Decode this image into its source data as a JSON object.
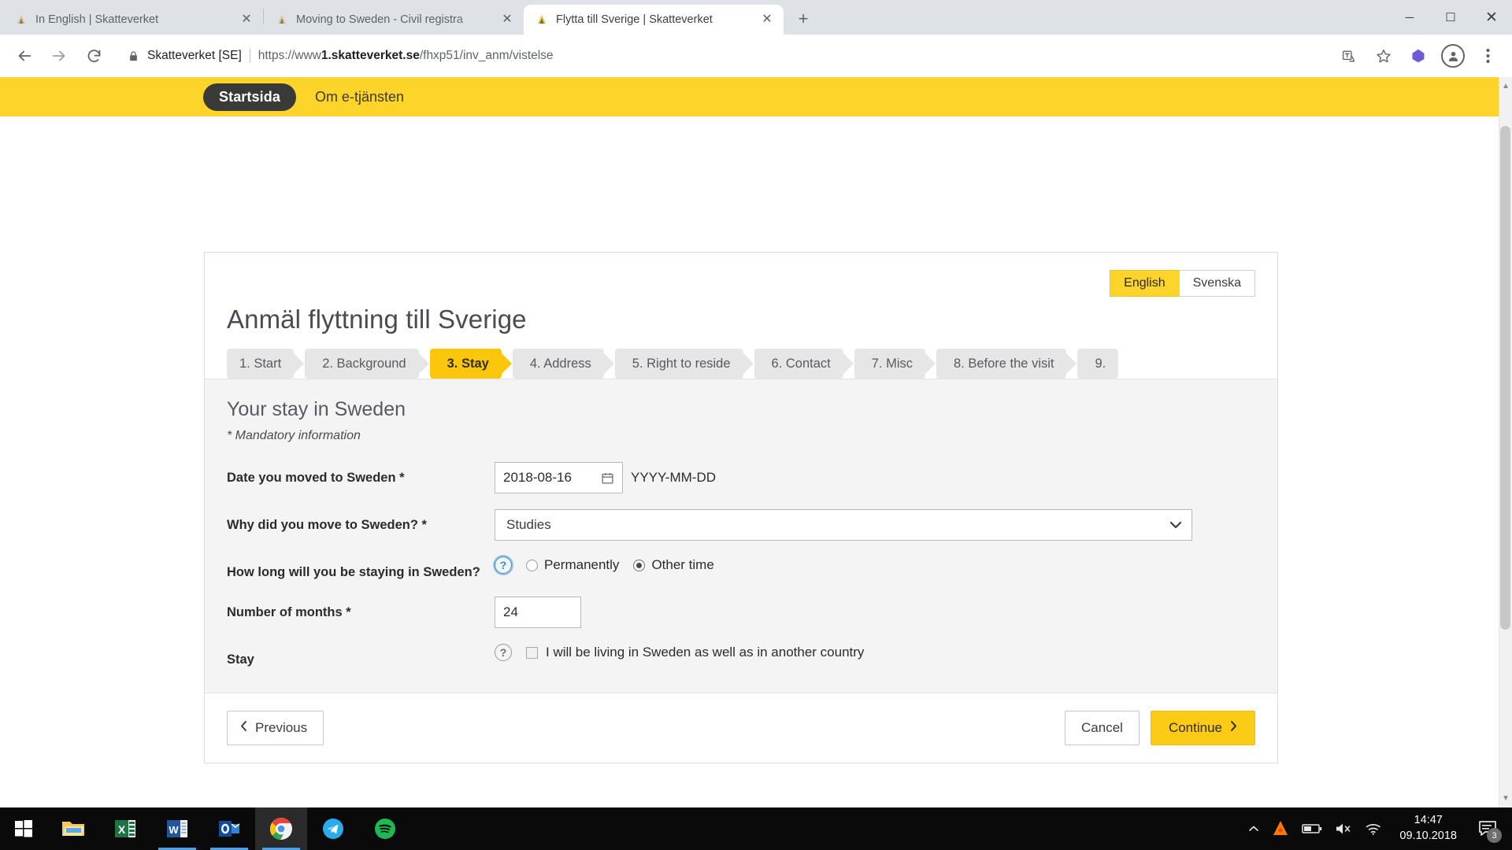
{
  "browser": {
    "tabs": [
      {
        "title": "In English | Skatteverket",
        "favicon": "skatteverket-favicon",
        "active": false
      },
      {
        "title": "Moving to Sweden - Civil registra",
        "favicon": "skatteverket-favicon",
        "active": false
      },
      {
        "title": "Flytta till Sverige | Skatteverket",
        "favicon": "skatteverket-favicon",
        "active": true
      }
    ],
    "new_tab_label": "+",
    "window_controls": {
      "minimize": "─",
      "maximize": "☐",
      "close": "✕"
    },
    "nav": {
      "back": "back-arrow-icon",
      "forward": "forward-arrow-icon",
      "reload": "reload-icon"
    },
    "omnibox": {
      "lock_icon": "lock-icon",
      "site_label": "Skatteverket [SE]",
      "url_prefix": "https://www",
      "url_bold": "1.skatteverket.se",
      "url_suffix": "/fhxp51/inv_anm/vistelse"
    },
    "toolbar_icons": [
      "translate-icon",
      "bookmark-star-icon",
      "extension-icon",
      "profile-avatar-icon",
      "more-menu-icon"
    ]
  },
  "topnav": {
    "home_label": "Startsida",
    "about_label": "Om e-tjänsten",
    "background_color": "#fdd42a"
  },
  "language": {
    "options": [
      "English",
      "Svenska"
    ],
    "selected": "English"
  },
  "page": {
    "title": "Anmäl flyttning till Sverige"
  },
  "steps": [
    {
      "label": "1. Start",
      "active": false
    },
    {
      "label": "2. Background",
      "active": false
    },
    {
      "label": "3. Stay",
      "active": true
    },
    {
      "label": "4. Address",
      "active": false
    },
    {
      "label": "5. Right to reside",
      "active": false
    },
    {
      "label": "6. Contact",
      "active": false
    },
    {
      "label": "7. Misc",
      "active": false
    },
    {
      "label": "8. Before the visit",
      "active": false
    },
    {
      "label": "9.",
      "active": false
    }
  ],
  "form": {
    "section_title": "Your stay in Sweden",
    "mandatory_note": "* Mandatory information",
    "date_moved": {
      "label": "Date you moved to Sweden *",
      "value": "2018-08-16",
      "format_hint": "YYYY-MM-DD",
      "calendar_icon": "calendar-icon"
    },
    "reason": {
      "label": "Why did you move to Sweden? *",
      "value": "Studies",
      "options": [
        "Studies"
      ],
      "chevron": "chevron-down-icon"
    },
    "duration": {
      "label": "How long will you be staying in Sweden?",
      "help_icon": "help-question-icon",
      "options": [
        {
          "label": "Permanently",
          "selected": false
        },
        {
          "label": "Other time",
          "selected": true
        }
      ]
    },
    "months": {
      "label": "Number of months *",
      "value": "24"
    },
    "stay": {
      "label": "Stay",
      "help_icon": "help-question-icon",
      "checkbox_label": "I will be living in Sweden as well as in another country",
      "checked": false
    }
  },
  "actions": {
    "previous": "Previous",
    "previous_icon": "chevron-left-icon",
    "cancel": "Cancel",
    "continue": "Continue",
    "continue_icon": "chevron-right-icon",
    "primary_color": "#fbcb16"
  },
  "taskbar": {
    "start_icon": "windows-start-icon",
    "items": [
      {
        "name": "file-explorer-icon",
        "running": false,
        "active": false
      },
      {
        "name": "excel-icon",
        "running": false,
        "active": false
      },
      {
        "name": "word-icon",
        "running": true,
        "active": false
      },
      {
        "name": "outlook-icon",
        "running": true,
        "active": false
      },
      {
        "name": "chrome-icon",
        "running": true,
        "active": true
      },
      {
        "name": "telegram-icon",
        "running": false,
        "active": false
      },
      {
        "name": "spotify-icon",
        "running": false,
        "active": false
      }
    ],
    "tray": [
      "show-hidden-icons-chevron",
      "avast-icon",
      "battery-icon",
      "volume-muted-icon",
      "wifi-icon"
    ],
    "clock_time": "14:47",
    "clock_date": "09.10.2018",
    "notification_count": "3"
  }
}
